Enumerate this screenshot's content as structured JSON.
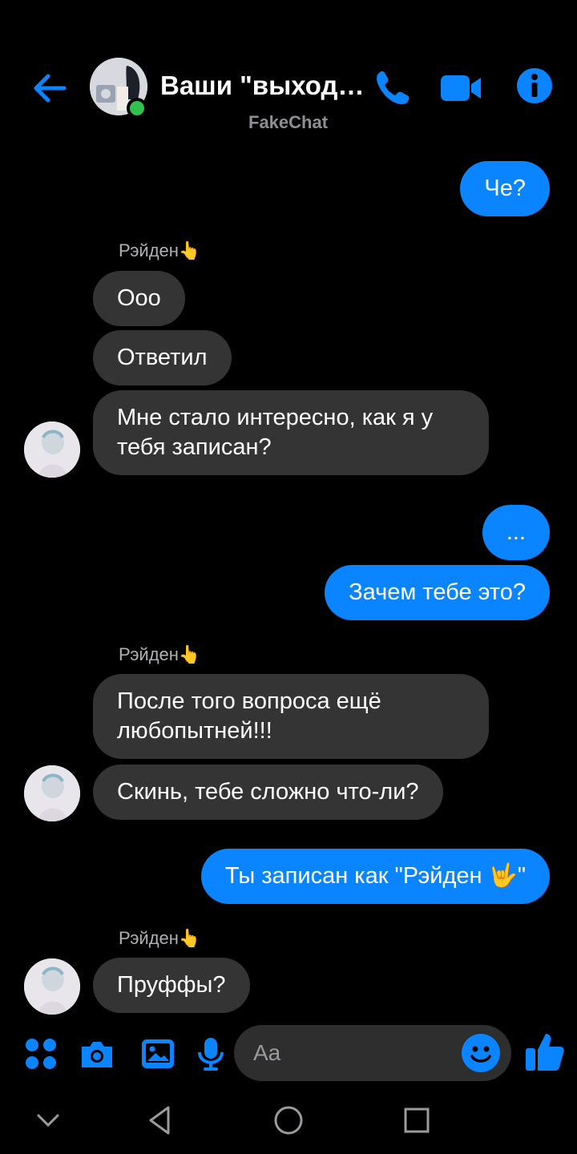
{
  "colors": {
    "accent": "#0a84ff",
    "background": "#000000",
    "incoming_bubble": "#343434",
    "online": "#31c24d"
  },
  "header": {
    "title": "Ваши \"выходн...",
    "subtitle": "FakeChat",
    "icons": [
      "back-arrow-icon",
      "phone-icon",
      "video-camera-icon",
      "info-icon"
    ]
  },
  "messages": [
    {
      "dir": "out",
      "text": "Че?"
    },
    {
      "sender": "Рэйден👆"
    },
    {
      "dir": "in",
      "text": "Ooo"
    },
    {
      "dir": "in",
      "text": "Ответил"
    },
    {
      "dir": "in",
      "text": "Мне стало интересно, как я у тебя записан?"
    },
    {
      "dir": "out",
      "text": "..."
    },
    {
      "dir": "out",
      "text": "Зачем тебе это?"
    },
    {
      "sender": "Рэйден👆"
    },
    {
      "dir": "in",
      "text": "После того вопроса ещё любопытней!!!"
    },
    {
      "dir": "in",
      "text": "Скинь, тебе сложно что-ли?"
    },
    {
      "dir": "out",
      "text": "Ты записан как \"Рэйден 🤟\""
    },
    {
      "sender": "Рэйден👆"
    },
    {
      "dir": "in",
      "text": "Пруффы?"
    }
  ],
  "composer": {
    "placeholder": "Aa",
    "icons": [
      "menu-dots-icon",
      "camera-icon",
      "gallery-icon",
      "microphone-icon",
      "emoji-icon",
      "thumbs-up-icon"
    ]
  },
  "navbar": {
    "icons": [
      "chevron-down-icon",
      "back-triangle-icon",
      "home-circle-icon",
      "recents-square-icon"
    ]
  }
}
